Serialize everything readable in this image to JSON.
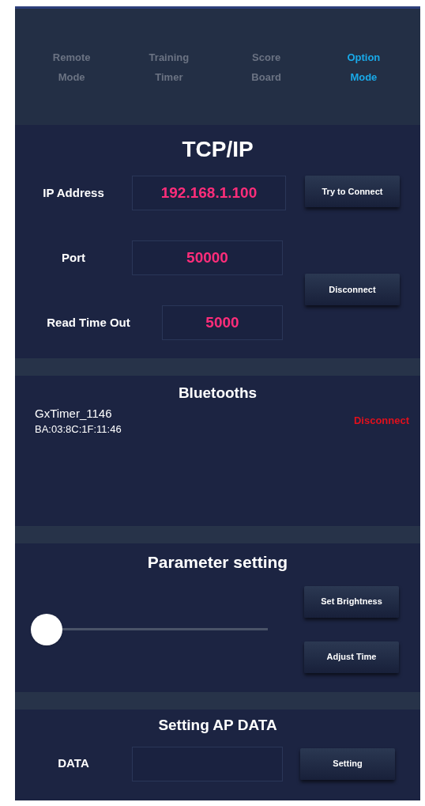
{
  "tabs": [
    {
      "label": "Remote Mode",
      "selected": false
    },
    {
      "label": "Training Timer",
      "selected": false
    },
    {
      "label": "Score Board",
      "selected": false
    },
    {
      "label": "Option Mode",
      "selected": true
    }
  ],
  "tcp_ip": {
    "title": "TCP/IP",
    "fields": [
      {
        "label": "IP Address",
        "value": "192.168.1.100"
      },
      {
        "label": "Port",
        "value": "50000"
      },
      {
        "label": "Read Time Out",
        "value": "5000"
      }
    ],
    "buttons": [
      "Try to Connect",
      "Disconnect"
    ]
  },
  "bluetooth": {
    "title": "Bluetooths",
    "devices": [
      {
        "name": "GxTimer_1146",
        "address": "BA:03:8C:1F:11:46",
        "action": "Disconnect"
      }
    ]
  },
  "parameter": {
    "title": "Parameter setting",
    "slider": {
      "level": 0
    },
    "buttons": [
      "Set Brightness",
      "Adjust Time"
    ]
  },
  "ap_data": {
    "title": "Setting AP DATA",
    "label": "DATA",
    "button": "Setting"
  }
}
